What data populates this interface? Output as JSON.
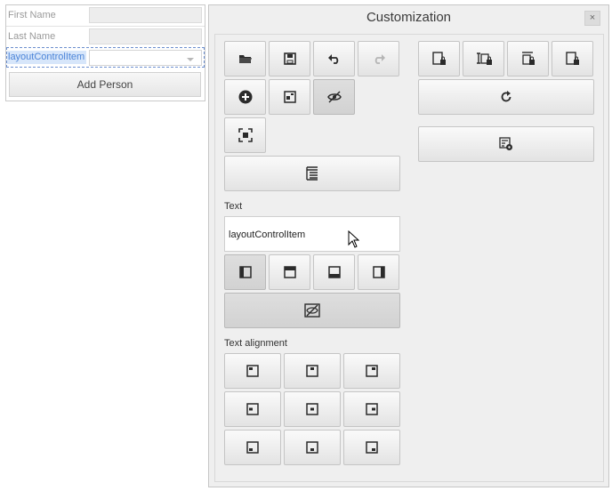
{
  "form": {
    "first_name_label": "First Name",
    "last_name_label": "Last Name",
    "selected_item_label": "layoutControlItem",
    "add_person_button": "Add Person"
  },
  "customization": {
    "title": "Customization",
    "close_glyph": "×",
    "text_section_label": "Text",
    "text_value": "layoutControlItem",
    "text_alignment_label": "Text alignment"
  },
  "icons": {
    "open": "open-folder-icon",
    "save": "save-icon",
    "undo": "undo-icon",
    "redo": "redo-icon",
    "add": "add-item-icon",
    "group": "group-icon",
    "hide": "hide-item-icon",
    "select_parent": "select-parent-icon",
    "tree": "layout-tree-icon",
    "lock_size": "size-constraint-icon",
    "reset": "reset-layout-icon",
    "properties": "properties-icon"
  },
  "colors": {
    "selection_accent": "#4b84d8",
    "window_bg": "#efefef"
  }
}
